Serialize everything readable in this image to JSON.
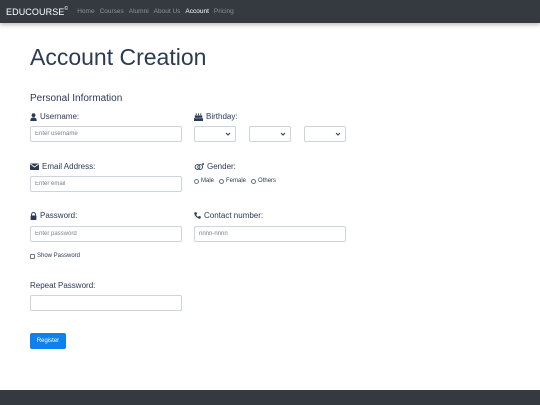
{
  "navbar": {
    "brand": "EDUCOURSE",
    "brand_mark": "©",
    "links": [
      "Home",
      "Courses",
      "Alumni",
      "About Us",
      "Account",
      "Pricing"
    ],
    "active": "Account"
  },
  "page": {
    "title": "Account Creation",
    "section": "Personal Information"
  },
  "form": {
    "username": {
      "label": "Username:",
      "placeholder": "Enter username",
      "icon": "user-icon"
    },
    "email": {
      "label": "Email Address:",
      "placeholder": "Enter email",
      "icon": "envelope-icon"
    },
    "password": {
      "label": "Password:",
      "placeholder": "Enter password",
      "icon": "lock-icon"
    },
    "show_password": "Show Password",
    "repeat_password": {
      "label": "Repeat Password:",
      "placeholder": ""
    },
    "birthday": {
      "label": "Birthday:",
      "icon": "birthday-cake-icon"
    },
    "gender": {
      "label": "Gender:",
      "icon": "gender-icon",
      "options": [
        "Male",
        "Female",
        "Others"
      ]
    },
    "contact": {
      "label": "Contact number:",
      "placeholder": "nnnn-nnnn",
      "icon": "phone-icon"
    },
    "submit": "Register"
  },
  "colors": {
    "navbar": "#343a40",
    "heading": "#2b3a55",
    "button": "#0d82ef"
  }
}
